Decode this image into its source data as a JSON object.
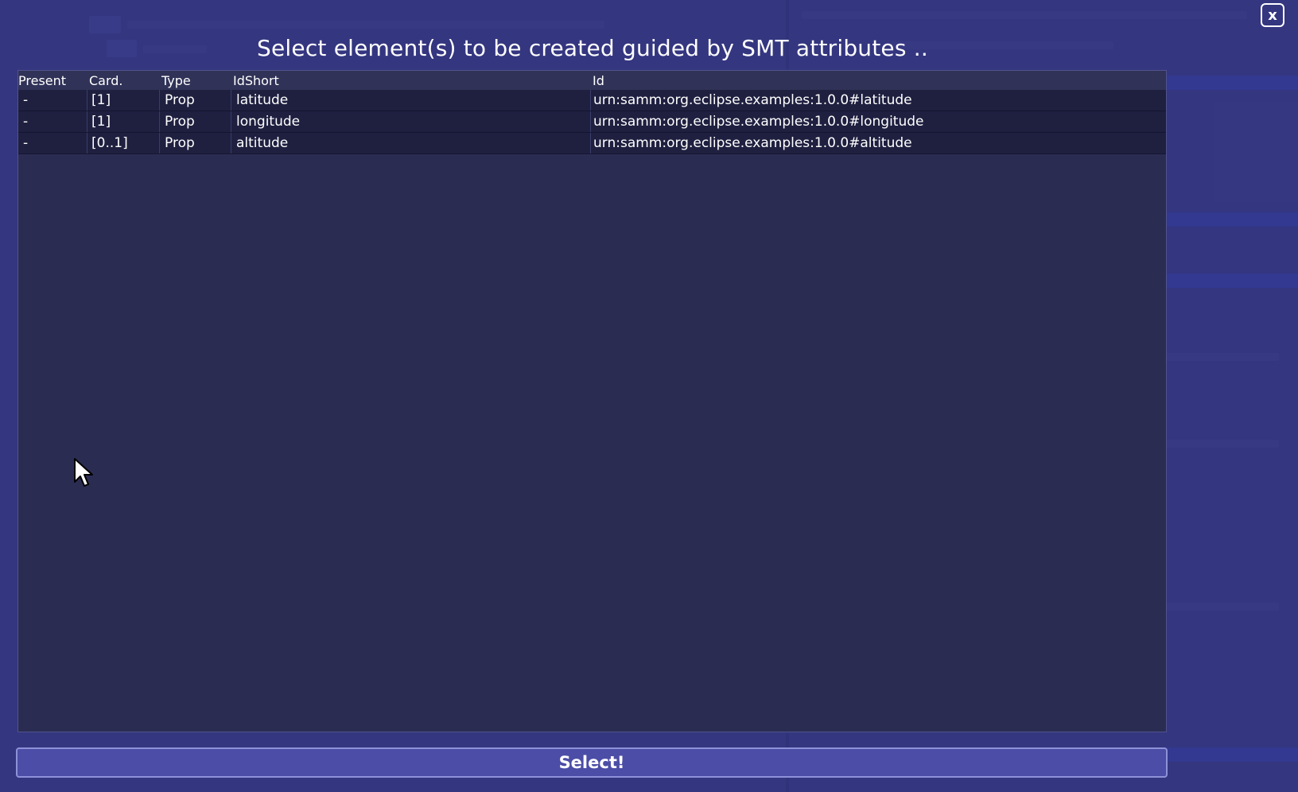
{
  "dialog": {
    "title": "Select element(s) to be created guided by SMT attributes ..",
    "close_label": "x",
    "select_label": "Select!"
  },
  "grid": {
    "columns": [
      "Present",
      "Card.",
      "Type",
      "IdShort",
      "Id"
    ],
    "rows": [
      {
        "present": "-",
        "card": "[1]",
        "type": "Prop",
        "idshort": "latitude",
        "id": "urn:samm:org.eclipse.examples:1.0.0#latitude"
      },
      {
        "present": "-",
        "card": "[1]",
        "type": "Prop",
        "idshort": "longitude",
        "id": "urn:samm:org.eclipse.examples:1.0.0#longitude"
      },
      {
        "present": "-",
        "card": "[0..1]",
        "type": "Prop",
        "idshort": "altitude",
        "id": "urn:samm:org.eclipse.examples:1.0.0#altitude"
      }
    ]
  },
  "colors": {
    "overlay": "#3c3e8c",
    "grid_background": "#2b2c52",
    "row_background": "#1f2040",
    "button_background": "#4b4da6"
  },
  "icons": [
    "close-icon",
    "mouse-pointer-icon"
  ]
}
